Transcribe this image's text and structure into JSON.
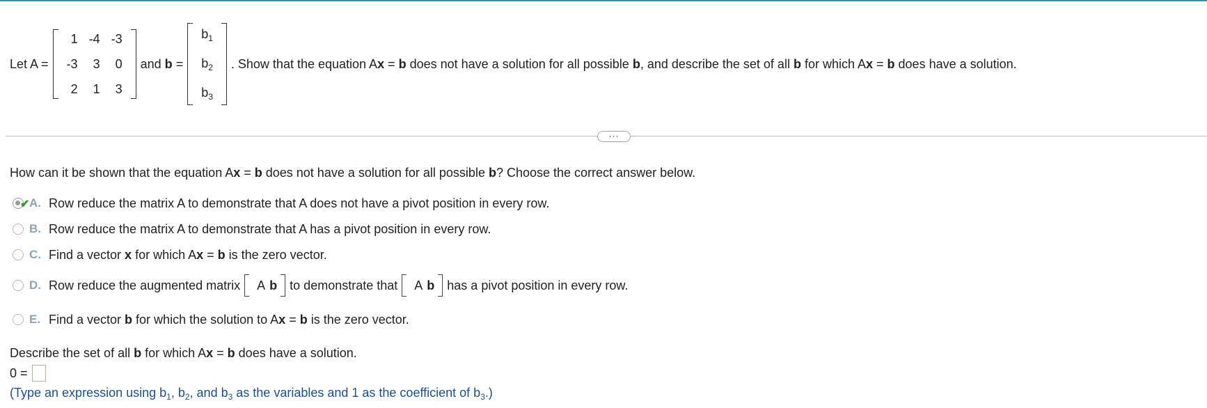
{
  "problem": {
    "let_a": "Let A =",
    "matrix_a": [
      [
        "1",
        "-4",
        "-3"
      ],
      [
        "-3",
        "3",
        "0"
      ],
      [
        "2",
        "1",
        "3"
      ]
    ],
    "and_b": "and",
    "b_sym": "b",
    "equals": "=",
    "vector_b": [
      {
        "base": "b",
        "sub": "1"
      },
      {
        "base": "b",
        "sub": "2"
      },
      {
        "base": "b",
        "sub": "3"
      }
    ],
    "text_1": ". Show that the equation A",
    "text_x": "x",
    "text_eq": " = ",
    "text_b": "b",
    "text_2": " does not have a solution for all possible ",
    "text_b2": "b",
    "text_3": ", and describe the set of all ",
    "text_b3": "b",
    "text_4": " for which A",
    "text_x2": "x",
    "text_eq2": " = ",
    "text_b4": "b",
    "text_5": " does have a solution."
  },
  "divider": {
    "more_label": "···"
  },
  "question": {
    "q1": "How can it be shown that the equation A",
    "q1_x": "x",
    "q1_eq": " = ",
    "q1_b": "b",
    "q1_mid": " does not have a solution for all possible ",
    "q1_b2": "b",
    "q1_end": "? Choose the correct answer below."
  },
  "options": {
    "a": {
      "letter": "A.",
      "text": "Row reduce the matrix A to demonstrate that A does not have a pivot position in every row.",
      "selected": true,
      "correct": true
    },
    "b": {
      "letter": "B.",
      "text": "Row reduce the matrix A to demonstrate that A has a pivot position in every row.",
      "selected": false
    },
    "c": {
      "letter": "C.",
      "pre": "Find a vector ",
      "x": "x",
      "mid": " for which A",
      "x2": "x",
      "eq": " = ",
      "b": "b",
      "post": " is the zero vector.",
      "selected": false
    },
    "d": {
      "letter": "D.",
      "pre": "Row reduce the augmented matrix",
      "aug_a": "A",
      "aug_b": "b",
      "mid": "to demonstrate that",
      "post": "has a pivot position in every row.",
      "selected": false
    },
    "e": {
      "letter": "E.",
      "pre": "Find a vector ",
      "b": "b",
      "mid": " for which the solution to A",
      "x": "x",
      "eq": " = ",
      "b2": "b",
      "post": " is the zero vector.",
      "selected": false
    }
  },
  "describe": {
    "pre": "Describe the set of all ",
    "b": "b",
    "mid": " for which A",
    "x": "x",
    "eq": " = ",
    "b2": "b",
    "post": " does have a solution."
  },
  "answer": {
    "label": "0 =",
    "value": ""
  },
  "hint": {
    "pre": "(Type an expression using b",
    "s1": "1",
    ", ": ", ",
    "b2": "b",
    "s2": "2",
    "and": ", and b",
    "s3": "3",
    "mid": " as the variables and 1 as the coefficient of b",
    "s4": "3",
    "end": ".)"
  },
  "colors": {
    "accent_line": "#3a8f9b",
    "check": "#2d9b2d",
    "letter": "#8fa3b5",
    "hint": "#1f4e8c",
    "answer_box": "#9ac38e"
  },
  "icons": {
    "check": "checkmark-icon"
  }
}
